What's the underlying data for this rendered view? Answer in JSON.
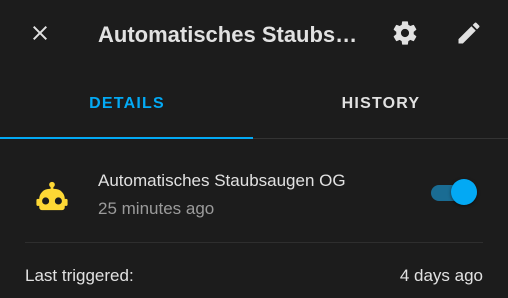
{
  "header": {
    "title": "Automatisches Staubsaugen OG",
    "close_icon": "close-icon",
    "settings_icon": "gear-icon",
    "edit_icon": "pencil-icon"
  },
  "tabs": [
    {
      "label": "DETAILS",
      "active": true
    },
    {
      "label": "HISTORY",
      "active": false
    }
  ],
  "entity": {
    "icon": "robot-icon",
    "name": "Automatisches Staubsaugen OG",
    "last_changed": "25 minutes ago",
    "enabled": true
  },
  "attributes": {
    "last_triggered_label": "Last triggered:",
    "last_triggered_value": "4 days ago"
  },
  "colors": {
    "background": "#1c1c1c",
    "accent": "#03a9f4",
    "text_primary": "#e1e1e1",
    "text_secondary": "#9b9b9b",
    "robot_icon": "#fdd835"
  }
}
